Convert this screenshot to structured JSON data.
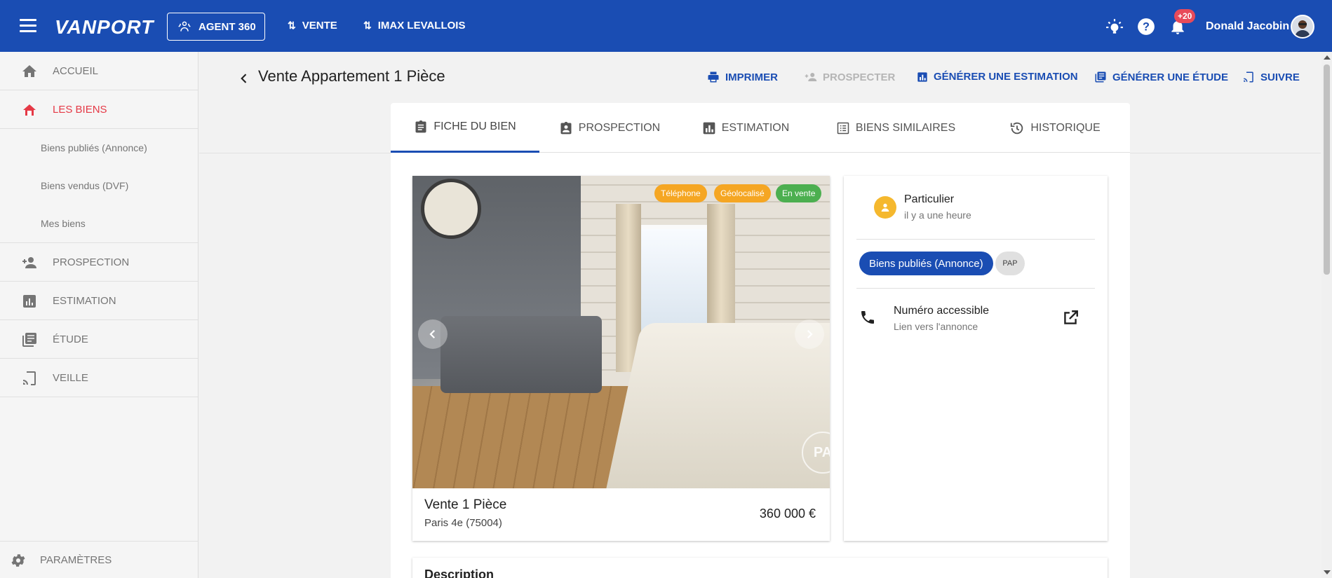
{
  "topbar": {
    "logo": "VANPORT",
    "agent_button": "AGENT 360",
    "nav_vente": "VENTE",
    "nav_agency": "IMAX LEVALLOIS",
    "notification_badge": "+20",
    "user_name": "Donald Jacobin",
    "accent": "#1a4db3"
  },
  "sidebar": {
    "items": [
      {
        "label": "ACCUEIL",
        "icon": "home-icon"
      },
      {
        "label": "LES BIENS",
        "icon": "biens-icon"
      },
      {
        "label": "PROSPECTION",
        "icon": "person-add-icon"
      },
      {
        "label": "ESTIMATION",
        "icon": "bar-chart-icon"
      },
      {
        "label": "ÉTUDE",
        "icon": "library-icon"
      },
      {
        "label": "VEILLE",
        "icon": "cast-icon"
      }
    ],
    "sub_items": [
      "Biens publiés (Annonce)",
      "Biens vendus (DVF)",
      "Mes biens"
    ],
    "settings": "PARAMÈTRES",
    "active_color": "#e53946"
  },
  "header": {
    "title": "Vente Appartement 1 Pièce",
    "actions": {
      "print": "IMPRIMER",
      "prospect": "PROSPECTER",
      "estimate": "GÉNÉRER UNE ESTIMATION",
      "study": "GÉNÉRER UNE ÉTUDE",
      "follow": "SUIVRE"
    }
  },
  "tabs": {
    "fiche": "FICHE DU BIEN",
    "prospection": "PROSPECTION",
    "estimation": "ESTIMATION",
    "similaires": "BIENS SIMILAIRES",
    "historique": "HISTORIQUE"
  },
  "listing": {
    "tags": [
      {
        "label": "Téléphone",
        "color": "#f5a623"
      },
      {
        "label": "Géolocalisé",
        "color": "#f5a623"
      },
      {
        "label": "En vente",
        "color": "#4caf50"
      }
    ],
    "watermark": "PA",
    "title": "Vente 1 Pièce",
    "location": "Paris 4e (75004)",
    "price": "360 000 €"
  },
  "info": {
    "owner_type": "Particulier",
    "owner_time": "il y a une heure",
    "chip_source": "Biens publiés (Annonce)",
    "chip_site": "PAP",
    "phone_title": "Numéro accessible",
    "phone_sub": "Lien vers l'annonce"
  },
  "description": {
    "title": "Description"
  }
}
